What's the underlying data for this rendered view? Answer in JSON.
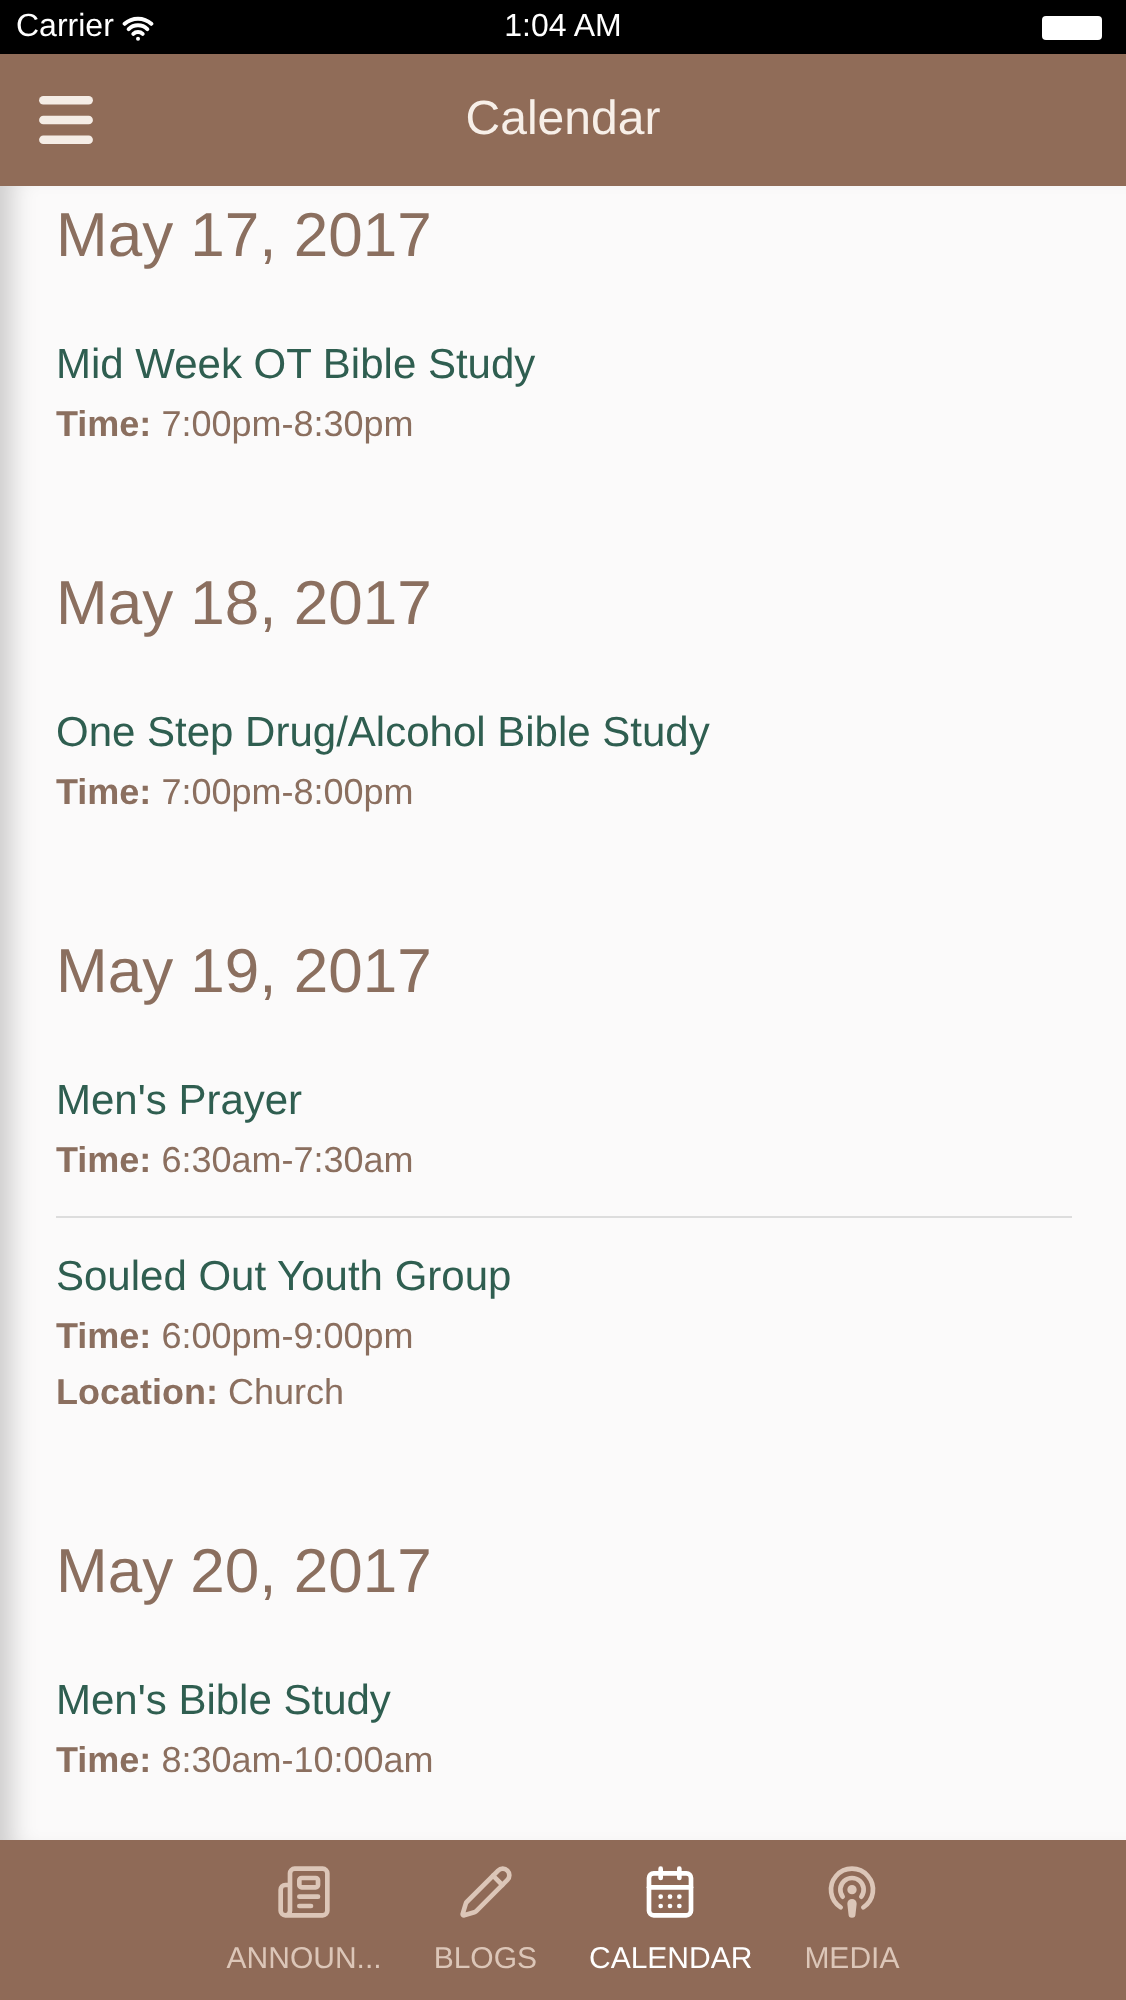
{
  "status_bar": {
    "carrier": "Carrier",
    "time": "1:04 AM"
  },
  "header": {
    "title": "Calendar"
  },
  "days": [
    {
      "date": "May 17, 2017",
      "events": [
        {
          "title": "Mid Week OT Bible Study",
          "details": [
            "**Time:** 7:00pm-8:30pm"
          ]
        }
      ]
    },
    {
      "date": "May 18, 2017",
      "events": [
        {
          "title": "One Step Drug/Alcohol Bible Study",
          "details": [
            "**Time:** 7:00pm-8:00pm"
          ]
        }
      ]
    },
    {
      "date": "May 19, 2017",
      "events": [
        {
          "title": "Men's Prayer",
          "details": [
            "**Time:** 6:30am-7:30am"
          ]
        },
        {
          "title": "Souled Out Youth Group",
          "details": [
            "**Time:** 6:00pm-9:00pm",
            "**Location:** Church"
          ]
        }
      ]
    },
    {
      "date": "May 20, 2017",
      "events": [
        {
          "title": "Men's Bible Study",
          "details": [
            "**Time:** 8:30am-10:00am"
          ]
        }
      ]
    }
  ],
  "tabs": [
    {
      "label": "ANNOUN...",
      "kind": "news",
      "selected": false
    },
    {
      "label": "BLOGS",
      "kind": "pencil",
      "selected": false
    },
    {
      "label": "CALENDAR",
      "kind": "calendar",
      "selected": true
    },
    {
      "label": "MEDIA",
      "kind": "podcast",
      "selected": false
    }
  ]
}
